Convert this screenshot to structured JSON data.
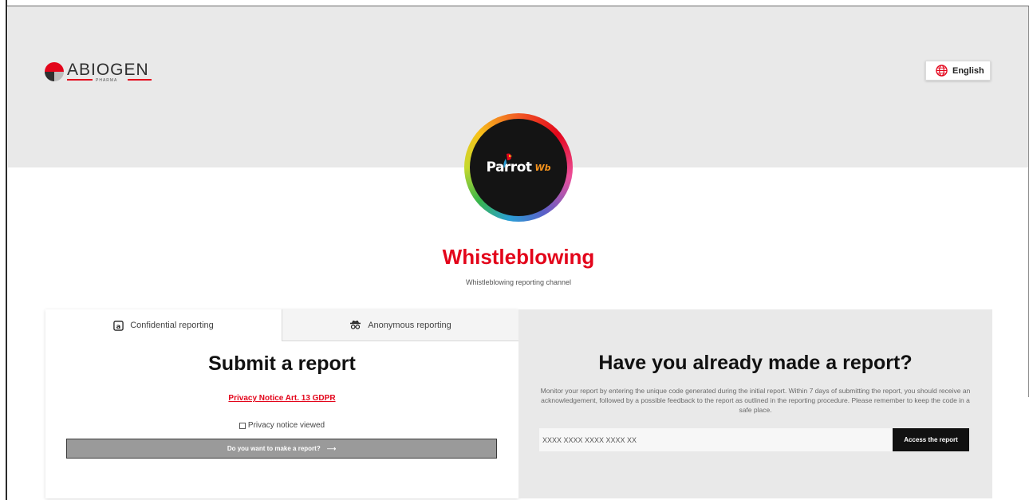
{
  "brand": {
    "name": "ABIOGEN",
    "subtext": "PHARMA",
    "accent_color": "#e3051b"
  },
  "language": {
    "icon": "globe-icon",
    "label": "English"
  },
  "parrot_logo": {
    "word": "Parrot",
    "mark": "Wb"
  },
  "page": {
    "title": "Whistleblowing",
    "subtitle": "Whistleblowing reporting channel"
  },
  "report_panel": {
    "tabs": [
      {
        "label": "Confidential reporting",
        "icon": "confidential-icon",
        "selected": true
      },
      {
        "label": "Anonymous reporting",
        "icon": "anonymous-spy-icon",
        "selected": false
      }
    ],
    "heading": "Submit a report",
    "privacy_link": "Privacy Notice Art. 13 GDPR",
    "privacy_check_label": "Privacy notice viewed",
    "make_report_label": "Do you want to make a report?",
    "make_report_arrow": "⟶"
  },
  "access_panel": {
    "heading": "Have you already made a report?",
    "description": "Monitor your report by entering the unique code generated during the initial report. Within 7 days of submitting the report, you should receive an acknowledgement, followed by a possible feedback to the report as outlined in the reporting procedure. Please remember to keep the code in a safe place.",
    "code_placeholder": "XXXX XXXX XXXX XXXX XX",
    "access_button": "Access the report"
  }
}
